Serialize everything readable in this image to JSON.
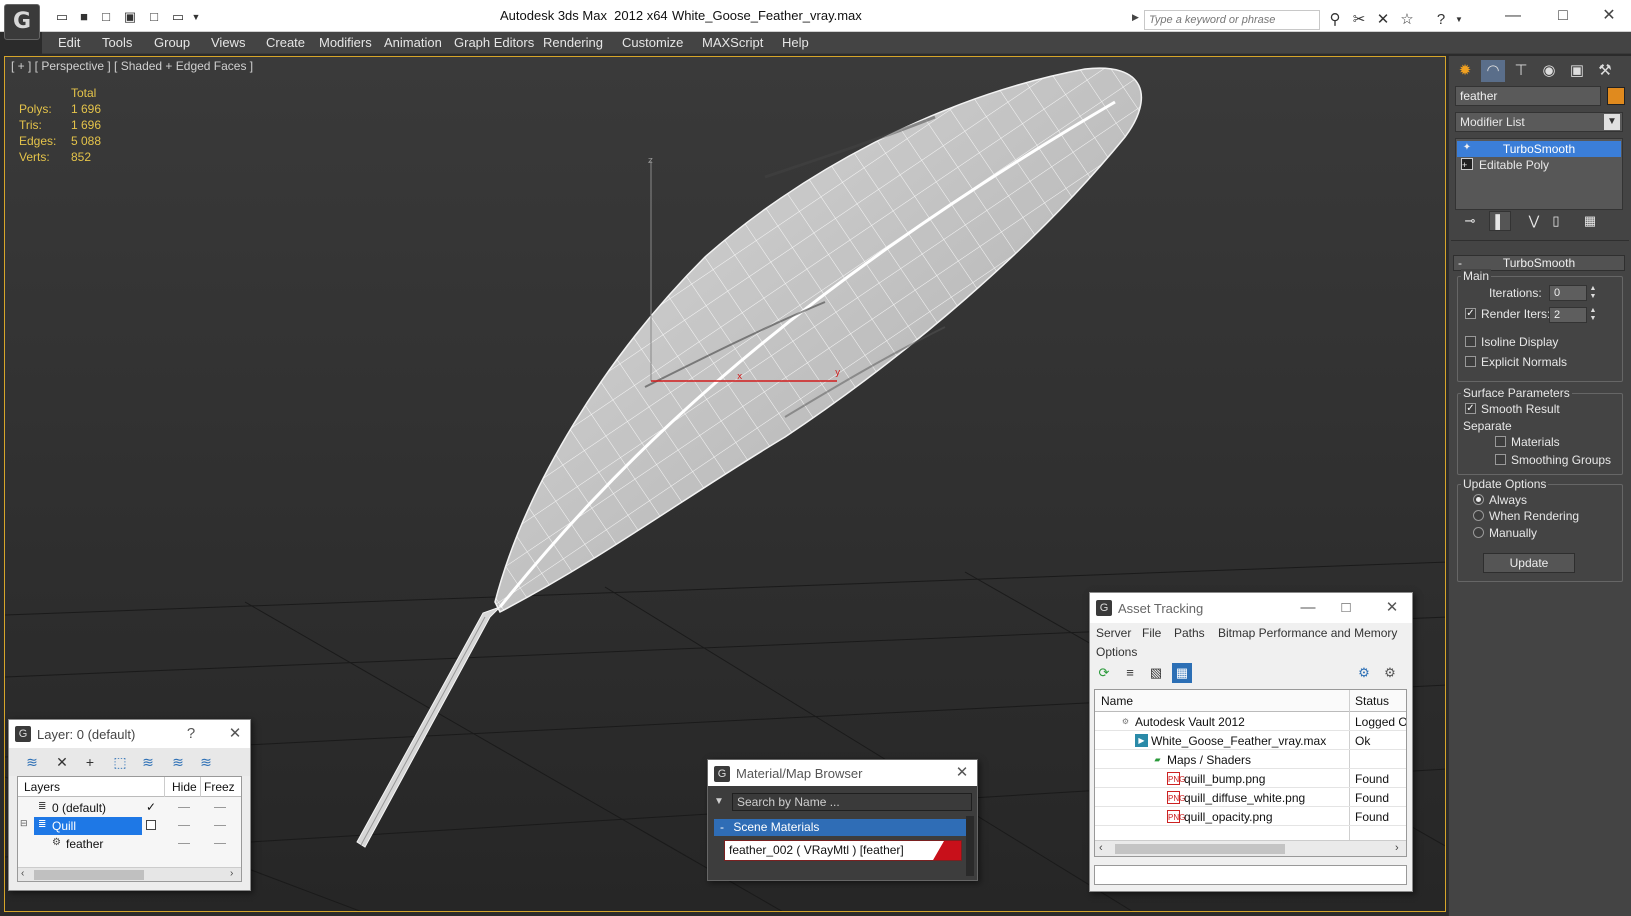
{
  "titlebar": {
    "app_title": "Autodesk 3ds Max  2012 x64",
    "file_title": "White_Goose_Feather_vray.max",
    "search_placeholder": "Type a keyword or phrase"
  },
  "menu": [
    "Edit",
    "Tools",
    "Group",
    "Views",
    "Create",
    "Modifiers",
    "Animation",
    "Graph Editors",
    "Rendering",
    "Customize",
    "MAXScript",
    "Help"
  ],
  "viewport": {
    "label": "[ + ] [ Perspective ] [ Shaded + Edged Faces ]",
    "stats_header": "Total",
    "stats": [
      {
        "label": "Polys:",
        "value": "1 696"
      },
      {
        "label": "Tris:",
        "value": "1 696"
      },
      {
        "label": "Edges:",
        "value": "5 088"
      },
      {
        "label": "Verts:",
        "value": "852"
      }
    ],
    "axis_labels": {
      "z": "z",
      "x": "x",
      "y": "y"
    }
  },
  "command_panel": {
    "object_name": "feather",
    "object_color": "#e08a1e",
    "modifier_list": "Modifier List",
    "stack": [
      "TurboSmooth",
      "Editable Poly"
    ],
    "rollout_title": "TurboSmooth",
    "main_group": "Main",
    "iterations_label": "Iterations:",
    "iterations_value": "0",
    "render_iters_label": "Render Iters:",
    "render_iters_value": "2",
    "render_iters_checked": true,
    "isoline_label": "Isoline Display",
    "explicit_normals_label": "Explicit Normals",
    "surface_group": "Surface Parameters",
    "smooth_result_label": "Smooth Result",
    "separate_label": "Separate",
    "materials_label": "Materials",
    "smoothing_groups_label": "Smoothing Groups",
    "update_group": "Update Options",
    "always_label": "Always",
    "when_rendering_label": "When Rendering",
    "manually_label": "Manually",
    "update_button": "Update"
  },
  "layer_window": {
    "title": "Layer: 0 (default)",
    "help": "?",
    "columns": [
      "Layers",
      "Hide",
      "Freez"
    ],
    "rows": [
      {
        "name": "0 (default)"
      },
      {
        "name": "Quill"
      },
      {
        "name": "feather"
      }
    ]
  },
  "material_browser": {
    "title": "Material/Map Browser",
    "search_placeholder": "Search by Name ...",
    "group": "Scene Materials",
    "group_toggle": "-",
    "item": "feather_002  ( VRayMtl )  [feather]"
  },
  "asset_tracking": {
    "title": "Asset Tracking",
    "menu": [
      "Server",
      "File",
      "Paths",
      "Bitmap Performance and Memory",
      "Options"
    ],
    "columns": [
      "Name",
      "Status"
    ],
    "rows": [
      {
        "name": "Autodesk Vault 2012",
        "status": "Logged Ou"
      },
      {
        "name": "White_Goose_Feather_vray.max",
        "status": "Ok"
      },
      {
        "name": "Maps / Shaders",
        "status": ""
      },
      {
        "name": "quill_bump.png",
        "status": "Found"
      },
      {
        "name": "quill_diffuse_white.png",
        "status": "Found"
      },
      {
        "name": "quill_opacity.png",
        "status": "Found"
      }
    ]
  },
  "icons": {
    "app": "3ds-max-logo",
    "selection_color": "#3b7ed8",
    "viewport_border": "#d6a52a",
    "stats_color": "#e4c34a"
  }
}
